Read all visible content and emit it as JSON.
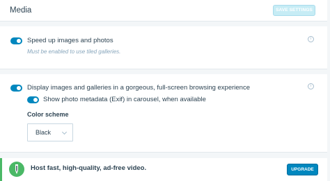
{
  "header": {
    "title": "Media",
    "save_label": "SAVE SETTINGS"
  },
  "tiled": {
    "label": "Speed up images and photos",
    "note": "Must be enabled to use tiled galleries.",
    "enabled": true
  },
  "carousel": {
    "label": "Display images and galleries in a gorgeous, full-screen browsing experience",
    "enabled": true,
    "exif_label": "Show photo metadata (Exif) in carousel, when available",
    "exif_enabled": true,
    "color_scheme_label": "Color scheme",
    "color_scheme_value": "Black"
  },
  "banner": {
    "text": "Host fast, high-quality, ad-free video.",
    "upgrade_label": "UPGRADE"
  },
  "colors": {
    "accent": "#0087be",
    "banner_accent": "#4ab866",
    "save_disabled": "#c6ecf5"
  },
  "icons": {
    "info": "info-icon",
    "chevron": "chevron-down-icon",
    "banner": "jetpack-icon"
  }
}
